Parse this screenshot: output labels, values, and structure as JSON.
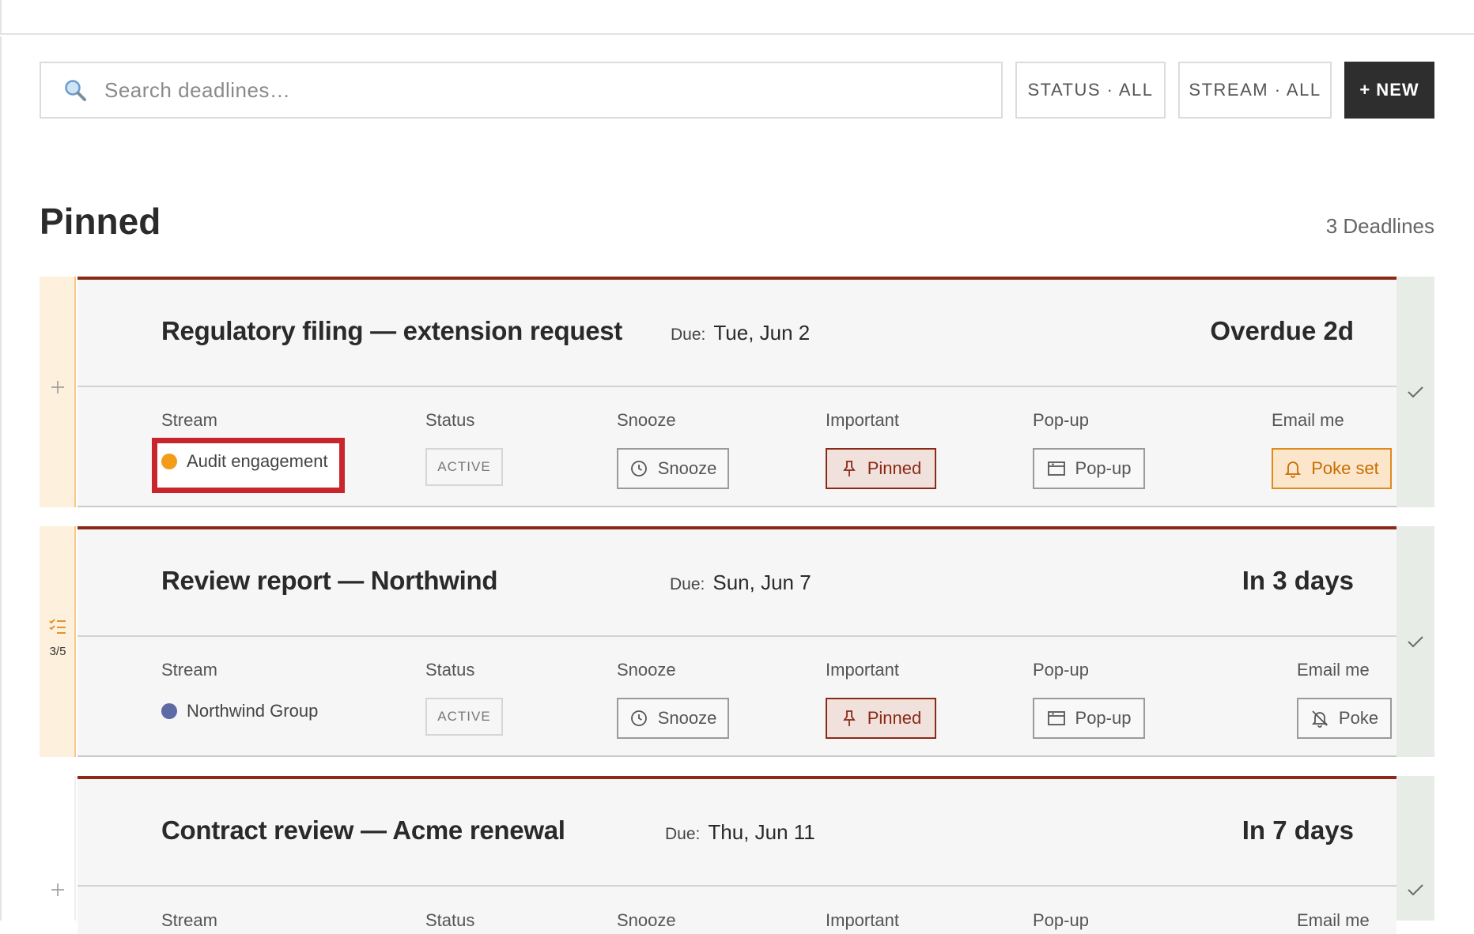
{
  "toolbar": {
    "search_placeholder": "Search deadlines…",
    "status_filter": "STATUS · ALL",
    "stream_filter": "STREAM · ALL",
    "new_button": "+ NEW"
  },
  "section": {
    "title": "Pinned",
    "count": "3 Deadlines"
  },
  "field_labels": {
    "stream": "Stream",
    "status": "Status",
    "snooze": "Snooze",
    "important": "Important",
    "popup": "Pop-up",
    "email": "Email me",
    "due": "Due:"
  },
  "colors": {
    "accent": "#8a2a16",
    "rail_highlight": "#fdf0dc",
    "done_rail": "#e7ece6",
    "audit_dot": "#f39c1a",
    "northwind_dot": "#5e6aa3",
    "highlight_box": "#c8262c"
  },
  "deadlines": [
    {
      "title": "Regulatory filing — extension request",
      "due": "Tue, Jun 2",
      "relative": "Overdue 2d",
      "stream": "Audit engagement",
      "status": "ACTIVE",
      "snooze": "Snooze",
      "important": "Pinned",
      "popup": "Pop-up",
      "email": "Poke set",
      "rail_icon": "plus-icon"
    },
    {
      "title": "Review report — Northwind",
      "due": "Sun, Jun 7",
      "relative": "In 3 days",
      "stream": "Northwind Group",
      "status": "ACTIVE",
      "snooze": "Snooze",
      "important": "Pinned",
      "popup": "Pop-up",
      "email": "Poke",
      "rail_icon": "checklist-icon",
      "checklist_progress": "3/5"
    },
    {
      "title": "Contract review — Acme renewal",
      "due": "Thu, Jun 11",
      "relative": "In 7 days",
      "stream": "Stream",
      "status": "Status",
      "snooze": "Snooze",
      "important": "Important",
      "popup": "Pop-up",
      "email": "Email me",
      "rail_icon": "plus-icon"
    }
  ]
}
